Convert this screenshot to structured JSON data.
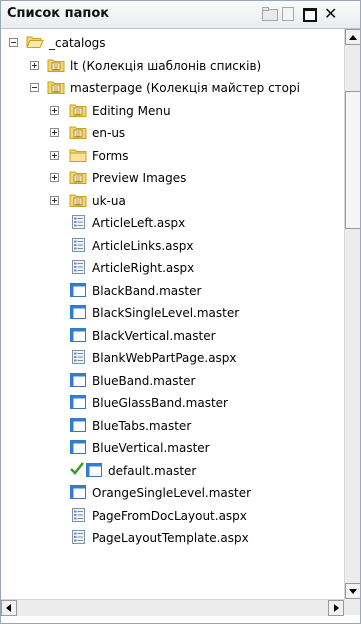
{
  "panel": {
    "title": "Список папок"
  },
  "tree": {
    "items": [
      {
        "label": "_catalogs",
        "icon": "open-folder-icon",
        "level": 0,
        "expander": "minus",
        "checked": false
      },
      {
        "label": "lt (Колекція шаблонів списків)",
        "icon": "list-folder-icon",
        "level": 1,
        "expander": "plus",
        "checked": false
      },
      {
        "label": "masterpage (Колекція майстер сторі",
        "icon": "list-folder-icon",
        "level": 1,
        "expander": "minus",
        "checked": false
      },
      {
        "label": "Editing Menu",
        "icon": "list-folder-icon",
        "level": 2,
        "expander": "plus",
        "checked": false
      },
      {
        "label": "en-us",
        "icon": "list-folder-icon",
        "level": 2,
        "expander": "plus",
        "checked": false
      },
      {
        "label": "Forms",
        "icon": "folder-icon",
        "level": 2,
        "expander": "plus",
        "checked": false
      },
      {
        "label": "Preview Images",
        "icon": "list-folder-icon",
        "level": 2,
        "expander": "plus",
        "checked": false
      },
      {
        "label": "uk-ua",
        "icon": "list-folder-icon",
        "level": 2,
        "expander": "plus",
        "checked": false
      },
      {
        "label": "ArticleLeft.aspx",
        "icon": "aspx-file-icon",
        "level": 2,
        "expander": "none",
        "checked": false
      },
      {
        "label": "ArticleLinks.aspx",
        "icon": "aspx-file-icon",
        "level": 2,
        "expander": "none",
        "checked": false
      },
      {
        "label": "ArticleRight.aspx",
        "icon": "aspx-file-icon",
        "level": 2,
        "expander": "none",
        "checked": false
      },
      {
        "label": "BlackBand.master",
        "icon": "master-file-icon",
        "level": 2,
        "expander": "none",
        "checked": false
      },
      {
        "label": "BlackSingleLevel.master",
        "icon": "master-file-icon",
        "level": 2,
        "expander": "none",
        "checked": false
      },
      {
        "label": "BlackVertical.master",
        "icon": "master-file-icon",
        "level": 2,
        "expander": "none",
        "checked": false
      },
      {
        "label": "BlankWebPartPage.aspx",
        "icon": "aspx-file-icon",
        "level": 2,
        "expander": "none",
        "checked": false
      },
      {
        "label": "BlueBand.master",
        "icon": "master-file-icon",
        "level": 2,
        "expander": "none",
        "checked": false
      },
      {
        "label": "BlueGlassBand.master",
        "icon": "master-file-icon",
        "level": 2,
        "expander": "none",
        "checked": false
      },
      {
        "label": "BlueTabs.master",
        "icon": "master-file-icon",
        "level": 2,
        "expander": "none",
        "checked": false
      },
      {
        "label": "BlueVertical.master",
        "icon": "master-file-icon",
        "level": 2,
        "expander": "none",
        "checked": false
      },
      {
        "label": "default.master",
        "icon": "master-file-icon",
        "level": 2,
        "expander": "none",
        "checked": true
      },
      {
        "label": "OrangeSingleLevel.master",
        "icon": "master-file-icon",
        "level": 2,
        "expander": "none",
        "checked": false
      },
      {
        "label": "PageFromDocLayout.aspx",
        "icon": "aspx-file-icon",
        "level": 2,
        "expander": "none",
        "checked": false
      },
      {
        "label": "PageLayoutTemplate.aspx",
        "icon": "aspx-file-icon",
        "level": 2,
        "expander": "none",
        "checked": false
      }
    ]
  },
  "colors": {
    "folder_yellow": "#f4d76b",
    "folder_dark": "#c9a227",
    "master_blue": "#2f7fd3",
    "check_green": "#3a9a2a",
    "scroll_bg": "#ececec"
  }
}
